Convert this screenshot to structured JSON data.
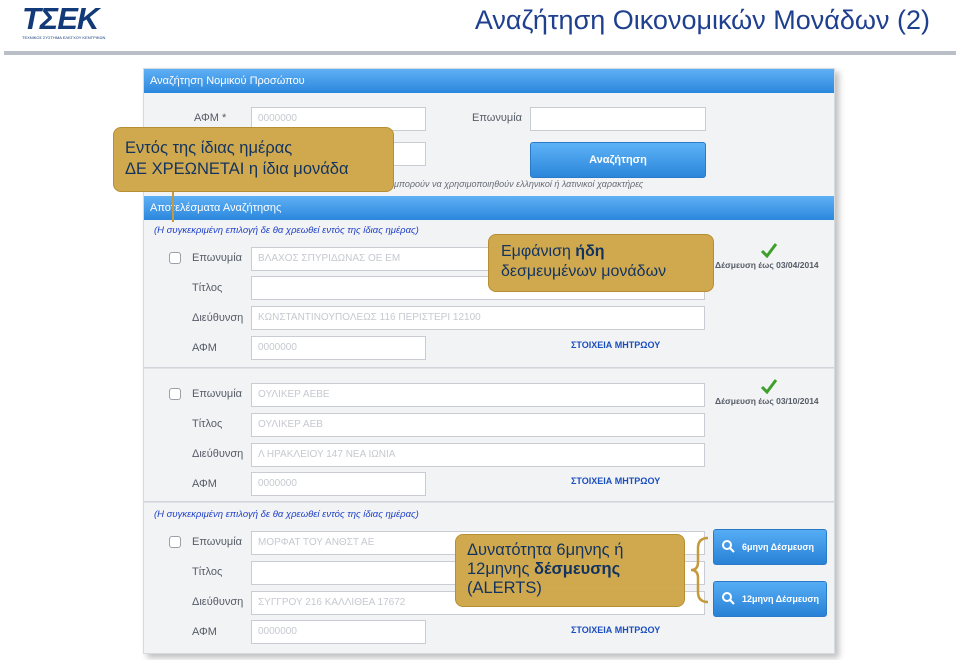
{
  "header": {
    "logo_text": "ΤΣΕΚ",
    "logo_subtext": "ΤΕΧΝΙΚΟΣ ΣΥΣΤΗΜΑ ΕΛΕΓΧΟΥ ΚΕΝΤΡΙΚΩΝ",
    "title": "Αναζήτηση Οικονομικών Μονάδων (2)"
  },
  "search_section": {
    "bar_title": "Αναζήτηση Νομικού Προσώπου",
    "afm_label": "ΑΦΜ *",
    "afm_value": "0000000",
    "name_label": "Επωνυμία",
    "name_value": "",
    "second_value": "",
    "search_button": "Αναζήτηση",
    "hint": "μπορούν να χρησιμοποιηθούν ελληνικοί ή λατινικοί χαρακτήρες"
  },
  "results_section": {
    "bar_title": "Αποτελέσματα Αναζήτησης",
    "notice": "(Η συγκεκριμένη επιλογή δε θα χρεωθεί εντός της ίδιας ημέρας)"
  },
  "labels": {
    "name": "Επωνυμία",
    "title": "Τίτλος",
    "address": "Διεύθυνση",
    "afm": "ΑΦΜ"
  },
  "results": [
    {
      "name": "ΒΛΑΧΟΣ ΣΠΥΡΙΔΩΝΑΣ ΟΕ ΕΜ",
      "title": "",
      "address": "ΚΩΝΣΤΑΝΤΙΝΟΥΠΟΛΕΩΣ 116 ΠΕΡΙΣΤΕΡΙ 12100",
      "afm": "0000000",
      "binding": "Δέσμευση έως 03/04/2014",
      "link": "ΣΤΟΙΧΕΙΑ ΜΗΤΡΩΟΥ"
    },
    {
      "name": "ΟΥΛΙΚΕΡ ΑΕΒΕ",
      "title": "ΟΥΛΙΚΕΡ ΑΕΒ",
      "address": "Λ ΗΡΑΚΛΕΙΟΥ 147 ΝΕΑ ΙΩΝΙΑ",
      "afm": "0000000",
      "binding": "Δέσμευση έως 03/10/2014",
      "link": "ΣΤΟΙΧΕΙΑ ΜΗΤΡΩΟΥ"
    },
    {
      "name": "ΜΟΡΦΑΤ ΤΟΥ ΑΝΘΣΤ ΑΕ",
      "title": "",
      "address": "ΣΥΓΓΡΟΥ 216 ΚΑΛΛΙΘΕΑ 17672",
      "afm": "0000000",
      "btn_6m": "6μηνη Δέσμευση",
      "btn_12m": "12μηνη Δέσμευση",
      "link": "ΣΤΟΙΧΕΙΑ ΜΗΤΡΩΟΥ"
    }
  ],
  "callouts": {
    "c1_line1": "Εντός της ίδιας ημέρας",
    "c1_line2": "ΔΕ ΧΡΕΩΝΕΤΑΙ η ίδια μονάδα",
    "c2_pre": "Εμφάνιση ",
    "c2_bold": "ήδη",
    "c2_line2": "δεσμευμένων μονάδων",
    "c3_line1": "Δυνατότητα 6μηνης ή",
    "c3_pre": "12μηνης ",
    "c3_bold": "δέσμευσης",
    "c3_line3": "(ALERTS)"
  },
  "colors": {
    "accent": "#2b87dc",
    "title": "#1f3f8f",
    "callout": "#cfa74a",
    "check": "#3ea02a"
  }
}
